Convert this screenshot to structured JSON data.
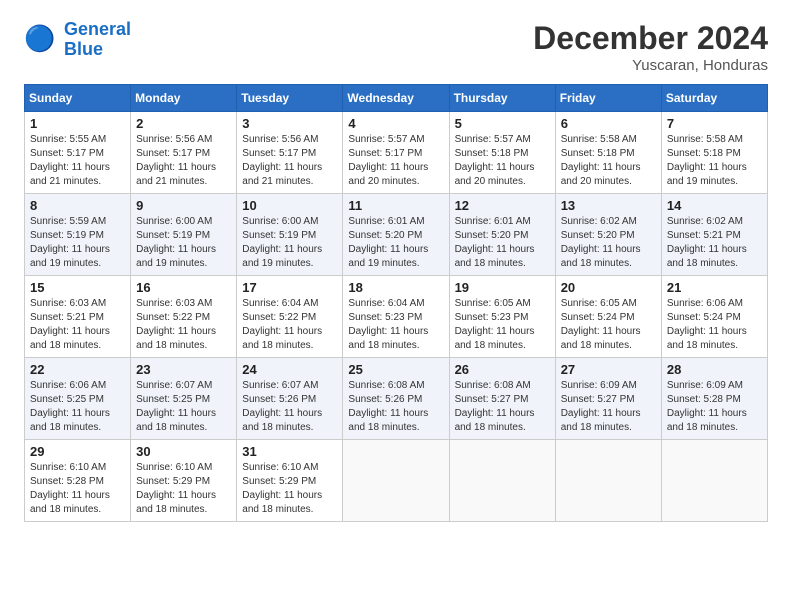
{
  "logo": {
    "line1": "General",
    "line2": "Blue"
  },
  "title": "December 2024",
  "subtitle": "Yuscaran, Honduras",
  "days_of_week": [
    "Sunday",
    "Monday",
    "Tuesday",
    "Wednesday",
    "Thursday",
    "Friday",
    "Saturday"
  ],
  "weeks": [
    [
      {
        "day": "1",
        "info": "Sunrise: 5:55 AM\nSunset: 5:17 PM\nDaylight: 11 hours\nand 21 minutes."
      },
      {
        "day": "2",
        "info": "Sunrise: 5:56 AM\nSunset: 5:17 PM\nDaylight: 11 hours\nand 21 minutes."
      },
      {
        "day": "3",
        "info": "Sunrise: 5:56 AM\nSunset: 5:17 PM\nDaylight: 11 hours\nand 21 minutes."
      },
      {
        "day": "4",
        "info": "Sunrise: 5:57 AM\nSunset: 5:17 PM\nDaylight: 11 hours\nand 20 minutes."
      },
      {
        "day": "5",
        "info": "Sunrise: 5:57 AM\nSunset: 5:18 PM\nDaylight: 11 hours\nand 20 minutes."
      },
      {
        "day": "6",
        "info": "Sunrise: 5:58 AM\nSunset: 5:18 PM\nDaylight: 11 hours\nand 20 minutes."
      },
      {
        "day": "7",
        "info": "Sunrise: 5:58 AM\nSunset: 5:18 PM\nDaylight: 11 hours\nand 19 minutes."
      }
    ],
    [
      {
        "day": "8",
        "info": "Sunrise: 5:59 AM\nSunset: 5:19 PM\nDaylight: 11 hours\nand 19 minutes."
      },
      {
        "day": "9",
        "info": "Sunrise: 6:00 AM\nSunset: 5:19 PM\nDaylight: 11 hours\nand 19 minutes."
      },
      {
        "day": "10",
        "info": "Sunrise: 6:00 AM\nSunset: 5:19 PM\nDaylight: 11 hours\nand 19 minutes."
      },
      {
        "day": "11",
        "info": "Sunrise: 6:01 AM\nSunset: 5:20 PM\nDaylight: 11 hours\nand 19 minutes."
      },
      {
        "day": "12",
        "info": "Sunrise: 6:01 AM\nSunset: 5:20 PM\nDaylight: 11 hours\nand 18 minutes."
      },
      {
        "day": "13",
        "info": "Sunrise: 6:02 AM\nSunset: 5:20 PM\nDaylight: 11 hours\nand 18 minutes."
      },
      {
        "day": "14",
        "info": "Sunrise: 6:02 AM\nSunset: 5:21 PM\nDaylight: 11 hours\nand 18 minutes."
      }
    ],
    [
      {
        "day": "15",
        "info": "Sunrise: 6:03 AM\nSunset: 5:21 PM\nDaylight: 11 hours\nand 18 minutes."
      },
      {
        "day": "16",
        "info": "Sunrise: 6:03 AM\nSunset: 5:22 PM\nDaylight: 11 hours\nand 18 minutes."
      },
      {
        "day": "17",
        "info": "Sunrise: 6:04 AM\nSunset: 5:22 PM\nDaylight: 11 hours\nand 18 minutes."
      },
      {
        "day": "18",
        "info": "Sunrise: 6:04 AM\nSunset: 5:23 PM\nDaylight: 11 hours\nand 18 minutes."
      },
      {
        "day": "19",
        "info": "Sunrise: 6:05 AM\nSunset: 5:23 PM\nDaylight: 11 hours\nand 18 minutes."
      },
      {
        "day": "20",
        "info": "Sunrise: 6:05 AM\nSunset: 5:24 PM\nDaylight: 11 hours\nand 18 minutes."
      },
      {
        "day": "21",
        "info": "Sunrise: 6:06 AM\nSunset: 5:24 PM\nDaylight: 11 hours\nand 18 minutes."
      }
    ],
    [
      {
        "day": "22",
        "info": "Sunrise: 6:06 AM\nSunset: 5:25 PM\nDaylight: 11 hours\nand 18 minutes."
      },
      {
        "day": "23",
        "info": "Sunrise: 6:07 AM\nSunset: 5:25 PM\nDaylight: 11 hours\nand 18 minutes."
      },
      {
        "day": "24",
        "info": "Sunrise: 6:07 AM\nSunset: 5:26 PM\nDaylight: 11 hours\nand 18 minutes."
      },
      {
        "day": "25",
        "info": "Sunrise: 6:08 AM\nSunset: 5:26 PM\nDaylight: 11 hours\nand 18 minutes."
      },
      {
        "day": "26",
        "info": "Sunrise: 6:08 AM\nSunset: 5:27 PM\nDaylight: 11 hours\nand 18 minutes."
      },
      {
        "day": "27",
        "info": "Sunrise: 6:09 AM\nSunset: 5:27 PM\nDaylight: 11 hours\nand 18 minutes."
      },
      {
        "day": "28",
        "info": "Sunrise: 6:09 AM\nSunset: 5:28 PM\nDaylight: 11 hours\nand 18 minutes."
      }
    ],
    [
      {
        "day": "29",
        "info": "Sunrise: 6:10 AM\nSunset: 5:28 PM\nDaylight: 11 hours\nand 18 minutes."
      },
      {
        "day": "30",
        "info": "Sunrise: 6:10 AM\nSunset: 5:29 PM\nDaylight: 11 hours\nand 18 minutes."
      },
      {
        "day": "31",
        "info": "Sunrise: 6:10 AM\nSunset: 5:29 PM\nDaylight: 11 hours\nand 18 minutes."
      },
      {
        "day": "",
        "info": ""
      },
      {
        "day": "",
        "info": ""
      },
      {
        "day": "",
        "info": ""
      },
      {
        "day": "",
        "info": ""
      }
    ]
  ]
}
